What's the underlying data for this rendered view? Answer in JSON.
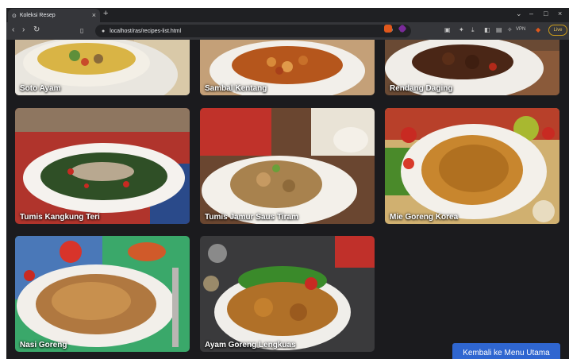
{
  "browser": {
    "tab_title": "Koleksi Resep",
    "url": "localhost/ras/recipes-list.html",
    "vpn_label": "VPN",
    "menu_label": "Live"
  },
  "recipes": [
    {
      "name": "Soto Ayam"
    },
    {
      "name": "Sambal Kentang"
    },
    {
      "name": "Rendang Daging"
    },
    {
      "name": "Tumis Kangkung Teri"
    },
    {
      "name": "Tumis Jamur Saus Tiram"
    },
    {
      "name": "Mie Goreng Korea"
    },
    {
      "name": "Nasi Goreng"
    },
    {
      "name": "Ayam Goreng Lengkuas"
    }
  ],
  "actions": {
    "back_label": "Kembali ke Menu Utama"
  },
  "colors": {
    "button": "#2f66d0",
    "background": "#1b1b1e"
  }
}
